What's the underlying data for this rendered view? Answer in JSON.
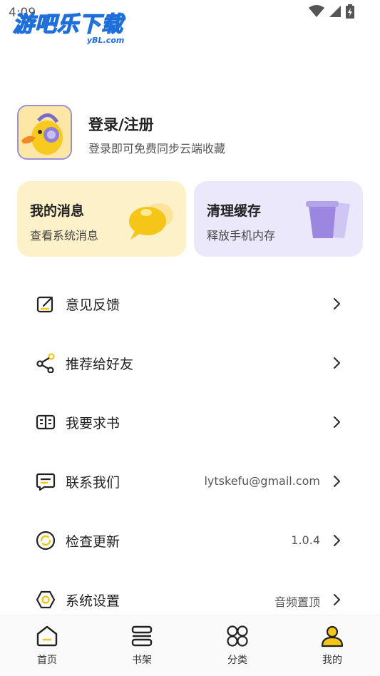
{
  "status_bar": {
    "time": "4:09"
  },
  "watermark": {
    "main": "游吧乐下载",
    "sub": "yBL.com"
  },
  "profile": {
    "title": "登录/注册",
    "subtitle": "登录即可免费同步云端收藏"
  },
  "cards": [
    {
      "title": "我的消息",
      "subtitle": "查看系统消息",
      "icon": "chat-bubbles-icon"
    },
    {
      "title": "清理缓存",
      "subtitle": "释放手机内存",
      "icon": "trash-bin-icon"
    }
  ],
  "menu": [
    {
      "label": "意见反馈",
      "value": "",
      "icon": "feedback-icon"
    },
    {
      "label": "推荐给好友",
      "value": "",
      "icon": "share-icon"
    },
    {
      "label": "我要求书",
      "value": "",
      "icon": "book-request-icon"
    },
    {
      "label": "联系我们",
      "value": "lytskefu@gmail.com",
      "icon": "contact-message-icon"
    },
    {
      "label": "检查更新",
      "value": "1.0.4",
      "icon": "update-icon"
    },
    {
      "label": "系统设置",
      "value": "音频置顶",
      "icon": "settings-icon"
    }
  ],
  "tabs": [
    {
      "label": "首页",
      "icon": "home-icon"
    },
    {
      "label": "书架",
      "icon": "bookshelf-icon"
    },
    {
      "label": "分类",
      "icon": "category-icon"
    },
    {
      "label": "我的",
      "icon": "profile-icon",
      "active": true
    }
  ],
  "colors": {
    "accent_yellow": "#f5c518",
    "card_yellow": "#fdf1c9",
    "card_purple": "#ebe8fb",
    "purple_icon": "#9b87e0",
    "text": "#222222"
  }
}
